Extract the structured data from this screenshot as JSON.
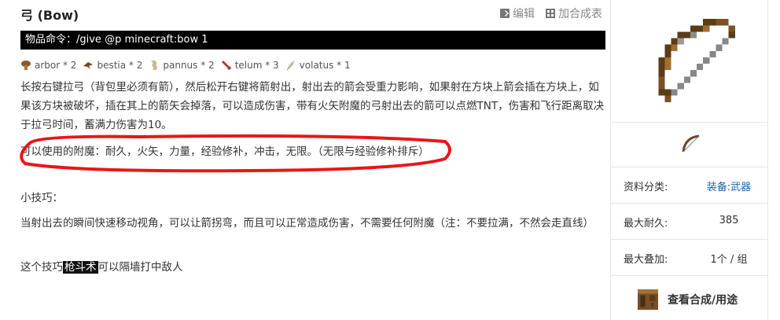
{
  "page": {
    "title": "弓 (Bow)",
    "edit_label": "编辑",
    "add_label": "加合成表"
  },
  "command": {
    "text": "物品命令：/give @p minecraft:bow 1"
  },
  "tags": [
    {
      "label": "arbor * 2",
      "icon": "mushroom-icon"
    },
    {
      "label": "bestia * 2",
      "icon": "bird-icon"
    },
    {
      "label": "pannus * 2",
      "icon": "cloth-icon"
    },
    {
      "label": "telum * 3",
      "icon": "sword-icon"
    },
    {
      "label": "volatus * 1",
      "icon": "feather-icon"
    }
  ],
  "content": {
    "p1": "长按右键拉弓（背包里必须有箭），然后松开右键将箭射出，射出去的箭会受重力影响，如果射在方块上箭会插在方块上，如果该方块被破坏，插在其上的箭矢会掉落，可以造成伤害，带有火矢附魔的弓射出去的箭可以点燃TNT，伤害和飞行距离取决于拉弓时间，蓄满力伤害为10。",
    "p2": "可以使用的附魔：耐久，火矢，力量，经验修补，冲击，无限。（无限与经验修补排斥）",
    "tip_head": "小技巧：",
    "p3": "当射出去的瞬间快速移动视角，可以让箭拐弯，而且可以正常造成伤害，不需要任何附魔（注：不要拉满，不然会走直线）",
    "p4_before": "这个技巧",
    "p4_highlight": "枪斗术",
    "p4_after": "可以隔墙打中敌人"
  },
  "infobox": {
    "rows": [
      {
        "key": "资料分类:",
        "value": "装备:武器"
      },
      {
        "key": "最大耐久:",
        "value": "385"
      },
      {
        "key": "最大叠加:",
        "value": "1个 / 组"
      }
    ],
    "recipe_label": "查看合成/用途"
  },
  "colors": {
    "accent_link": "#1a64b0",
    "annotation": "#e8161b",
    "command_bg": "#000000"
  }
}
